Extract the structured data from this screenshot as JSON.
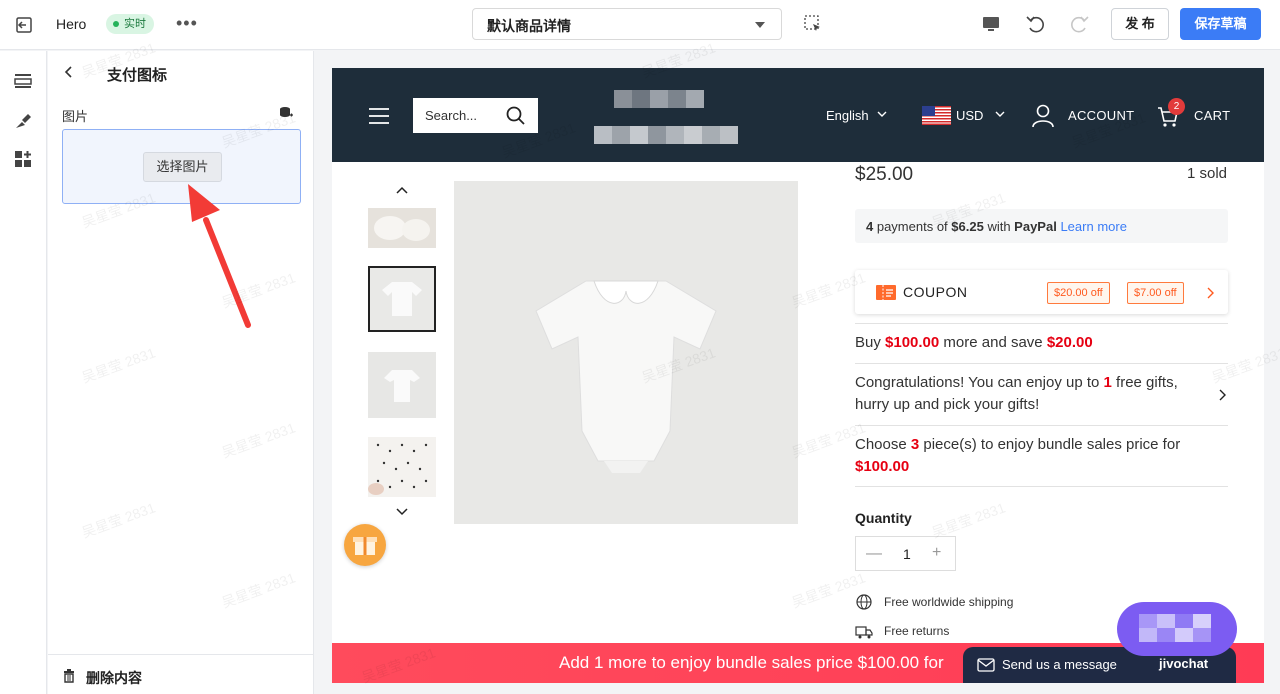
{
  "topbar": {
    "title": "Hero",
    "status_badge": "实时",
    "more": "•••",
    "page_select": "默认商品详情",
    "publish_label": "发 布",
    "save_draft_label": "保存草稿"
  },
  "panel": {
    "title": "支付图标",
    "image_label": "图片",
    "select_image_label": "选择图片",
    "delete_label": "删除内容"
  },
  "store": {
    "search_placeholder": "Search...",
    "language": "English",
    "currency": "USD",
    "account": "ACCOUNT",
    "cart": "CART",
    "cart_count": "2"
  },
  "product": {
    "price": "$25.00",
    "sold": "1 sold",
    "paypal": {
      "count": "4",
      "text1": " payments of ",
      "amount": "$6.25",
      "text2": " with ",
      "brand": "PayPal",
      "link": "Learn more"
    },
    "coupon": {
      "label": "COUPON",
      "tags": [
        "$20.00 off",
        "$7.00 off"
      ]
    },
    "offer_buy": {
      "pre": "Buy ",
      "amount": "$100.00",
      "mid": " more and save ",
      "save": "$20.00"
    },
    "offer_gift": {
      "pre": "Congratulations! You can enjoy up to ",
      "count": "1",
      "post": " free gifts, hurry up and pick your gifts!"
    },
    "offer_bundle": {
      "pre": "Choose ",
      "count": "3",
      "mid": " piece(s) to enjoy bundle sales price for ",
      "price": "$100.00"
    },
    "quantity_label": "Quantity",
    "quantity_value": "1",
    "qty_minus": "—",
    "qty_plus": "+",
    "features": [
      "Free worldwide shipping",
      "Free returns"
    ]
  },
  "bundle_bar": "Add 1 more to enjoy bundle sales price $100.00 for",
  "chat": {
    "message": "Send us a message",
    "brand": "jivochat"
  },
  "watermark": "吴星莹 2831",
  "colors": {
    "accent": "#3b7cf6",
    "header": "#1e2d3a",
    "sale_red": "#e60012",
    "coupon_orange": "#ff5a1f"
  }
}
